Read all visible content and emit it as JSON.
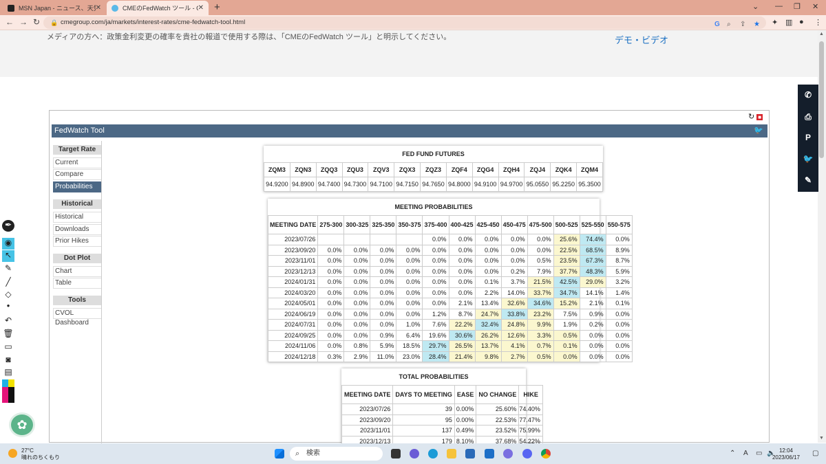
{
  "browser": {
    "tabs": [
      {
        "title": "MSN Japan - ニュース、天気, メール (",
        "active": false
      },
      {
        "title": "CMEのFedWatch ツール - CME Gro",
        "active": true
      }
    ],
    "url": "cmegroup.com/ja/markets/interest-rates/cme-fedwatch-tool.html",
    "new_tab": "+"
  },
  "page": {
    "media_note": "メディアの方へ：政策金利変更の確率を貴社の報道で使用する際は、「CMEのFedWatch ツール」と明示してください。",
    "demo_link": "デモ・ビデオ"
  },
  "fedwatch": {
    "title": "FedWatch Tool",
    "nav": {
      "target_rate": "Target Rate",
      "target_items": [
        "Current",
        "Compare",
        "Probabilities"
      ],
      "historical": "Historical",
      "historical_items": [
        "Historical",
        "Downloads",
        "Prior Hikes"
      ],
      "dot_plot": "Dot Plot",
      "dot_items": [
        "Chart",
        "Table"
      ],
      "tools": "Tools",
      "tools_items": [
        "CVOL Dashboard"
      ]
    },
    "futures": {
      "title": "FED FUND FUTURES",
      "headers": [
        "ZQM3",
        "ZQN3",
        "ZQQ3",
        "ZQU3",
        "ZQV3",
        "ZQX3",
        "ZQZ3",
        "ZQF4",
        "ZQG4",
        "ZQH4",
        "ZQJ4",
        "ZQK4",
        "ZQM4"
      ],
      "values": [
        "94.9200",
        "94.8900",
        "94.7400",
        "94.7300",
        "94.7100",
        "94.7150",
        "94.7650",
        "94.8000",
        "94.9100",
        "94.9700",
        "95.0550",
        "95.2250",
        "95.3500"
      ]
    },
    "meeting": {
      "title": "MEETING PROBABILITIES",
      "headers": [
        "MEETING DATE",
        "275-300",
        "300-325",
        "325-350",
        "350-375",
        "375-400",
        "400-425",
        "425-450",
        "450-475",
        "475-500",
        "500-525",
        "525-550",
        "550-575"
      ],
      "rows": [
        [
          "2023/07/26",
          "",
          "",
          "",
          "",
          "0.0%",
          "0.0%",
          "0.0%",
          "0.0%",
          "0.0%",
          "25.6%",
          "74.4%",
          "0.0%"
        ],
        [
          "2023/09/20",
          "0.0%",
          "0.0%",
          "0.0%",
          "0.0%",
          "0.0%",
          "0.0%",
          "0.0%",
          "0.0%",
          "0.0%",
          "22.5%",
          "68.5%",
          "8.9%"
        ],
        [
          "2023/11/01",
          "0.0%",
          "0.0%",
          "0.0%",
          "0.0%",
          "0.0%",
          "0.0%",
          "0.0%",
          "0.0%",
          "0.5%",
          "23.5%",
          "67.3%",
          "8.7%"
        ],
        [
          "2023/12/13",
          "0.0%",
          "0.0%",
          "0.0%",
          "0.0%",
          "0.0%",
          "0.0%",
          "0.0%",
          "0.2%",
          "7.9%",
          "37.7%",
          "48.3%",
          "5.9%"
        ],
        [
          "2024/01/31",
          "0.0%",
          "0.0%",
          "0.0%",
          "0.0%",
          "0.0%",
          "0.0%",
          "0.1%",
          "3.7%",
          "21.5%",
          "42.5%",
          "29.0%",
          "3.2%"
        ],
        [
          "2024/03/20",
          "0.0%",
          "0.0%",
          "0.0%",
          "0.0%",
          "0.0%",
          "0.0%",
          "2.2%",
          "14.0%",
          "33.7%",
          "34.7%",
          "14.1%",
          "1.4%"
        ],
        [
          "2024/05/01",
          "0.0%",
          "0.0%",
          "0.0%",
          "0.0%",
          "0.0%",
          "2.1%",
          "13.4%",
          "32.6%",
          "34.6%",
          "15.2%",
          "2.1%",
          "0.1%"
        ],
        [
          "2024/06/19",
          "0.0%",
          "0.0%",
          "0.0%",
          "0.0%",
          "1.2%",
          "8.7%",
          "24.7%",
          "33.8%",
          "23.2%",
          "7.5%",
          "0.9%",
          "0.0%"
        ],
        [
          "2024/07/31",
          "0.0%",
          "0.0%",
          "0.0%",
          "1.0%",
          "7.6%",
          "22.2%",
          "32.4%",
          "24.8%",
          "9.9%",
          "1.9%",
          "0.2%",
          "0.0%"
        ],
        [
          "2024/09/25",
          "0.0%",
          "0.0%",
          "0.9%",
          "6.4%",
          "19.6%",
          "30.6%",
          "26.2%",
          "12.6%",
          "3.3%",
          "0.5%",
          "0.0%",
          "0.0%"
        ],
        [
          "2024/11/06",
          "0.0%",
          "0.8%",
          "5.9%",
          "18.5%",
          "29.7%",
          "26.5%",
          "13.7%",
          "4.1%",
          "0.7%",
          "0.1%",
          "0.0%",
          "0.0%"
        ],
        [
          "2024/12/18",
          "0.3%",
          "2.9%",
          "11.0%",
          "23.0%",
          "28.4%",
          "21.4%",
          "9.8%",
          "2.7%",
          "0.5%",
          "0.0%",
          "0.0%",
          "0.0%"
        ]
      ],
      "highlight_colors": {
        "yellow": "#fbf7cf",
        "blue": "#bfe9f2"
      },
      "highlights": [
        {
          "row": 0,
          "yellow": [
            10
          ],
          "blue": [
            11
          ]
        },
        {
          "row": 1,
          "yellow": [
            10
          ],
          "blue": [
            11
          ]
        },
        {
          "row": 2,
          "yellow": [
            10
          ],
          "blue": [
            11
          ]
        },
        {
          "row": 3,
          "yellow": [
            10
          ],
          "blue": [
            11
          ]
        },
        {
          "row": 4,
          "yellow": [
            9,
            11
          ],
          "blue": [
            10
          ]
        },
        {
          "row": 5,
          "yellow": [
            9
          ],
          "blue": [
            10
          ]
        },
        {
          "row": 6,
          "yellow": [
            8,
            10
          ],
          "blue": [
            9
          ]
        },
        {
          "row": 7,
          "yellow": [
            7,
            9
          ],
          "blue": [
            8
          ]
        },
        {
          "row": 8,
          "yellow": [
            6,
            8,
            9
          ],
          "blue": [
            7
          ]
        },
        {
          "row": 9,
          "yellow": [
            7,
            8,
            9,
            10
          ],
          "blue": [
            6
          ]
        },
        {
          "row": 10,
          "yellow": [
            6,
            7,
            8,
            9,
            10
          ],
          "blue": [
            5
          ]
        },
        {
          "row": 11,
          "yellow": [
            6,
            7,
            8,
            9,
            10
          ],
          "blue": [
            5
          ]
        }
      ]
    },
    "totals": {
      "title": "TOTAL PROBABILITIES",
      "headers": [
        "MEETING DATE",
        "DAYS TO MEETING",
        "EASE",
        "NO CHANGE",
        "HIKE"
      ],
      "rows": [
        [
          "2023/07/26",
          "39",
          "0.00%",
          "25.60%",
          "74.40%"
        ],
        [
          "2023/09/20",
          "95",
          "0.00%",
          "22.53%",
          "77.47%"
        ],
        [
          "2023/11/01",
          "137",
          "0.49%",
          "23.52%",
          "75.99%"
        ],
        [
          "2023/12/13",
          "179",
          "8.10%",
          "37.68%",
          "54.22%"
        ]
      ]
    }
  },
  "taskbar": {
    "weather_temp": "27°C",
    "weather_desc": "晴れのちくもり",
    "search": "検索",
    "ime": "A",
    "time": "12:04",
    "date": "2023/06/17"
  }
}
